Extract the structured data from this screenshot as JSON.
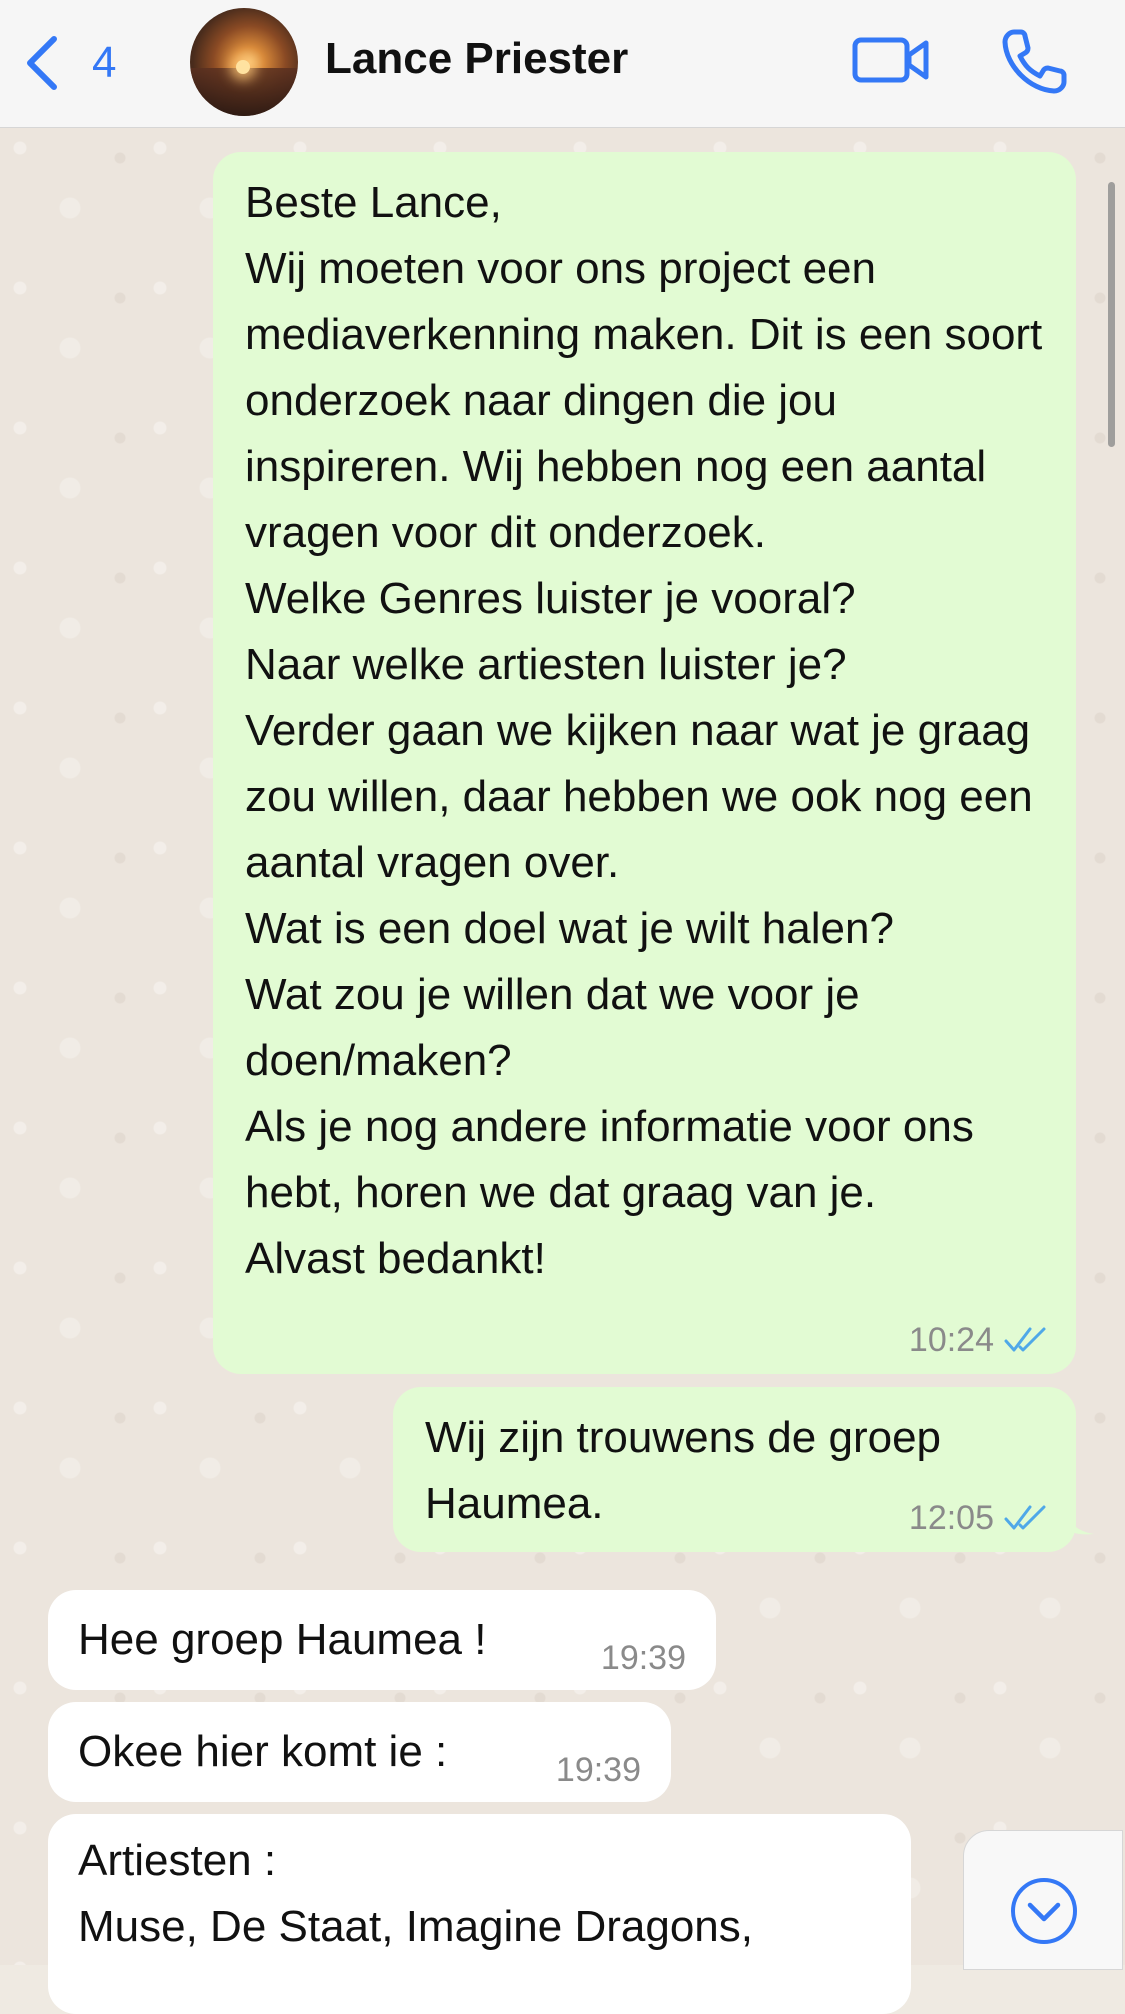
{
  "header": {
    "back_count": "4",
    "contact_name": "Lance Priester"
  },
  "messages": [
    {
      "direction": "out",
      "text": "Beste Lance,\nWij moeten voor ons project een mediaverkenning maken. Dit is een soort onderzoek naar dingen die jou inspireren. Wij hebben nog een aantal vragen voor dit onderzoek.\nWelke Genres luister je vooral?\nNaar welke artiesten luister je?\nVerder gaan we kijken naar wat je graag zou willen, daar hebben we ook nog een aantal vragen over.\nWat is een doel wat je wilt halen?\nWat zou je willen dat we voor je doen/maken?\nAls je nog andere informatie voor ons hebt, horen we dat graag van je.\nAlvast bedankt!",
      "time": "10:24",
      "status": "read"
    },
    {
      "direction": "out",
      "text": "Wij zijn trouwens de groep Haumea.",
      "time": "12:05",
      "status": "read"
    },
    {
      "direction": "in",
      "text": "Hee groep Haumea !",
      "time": "19:39"
    },
    {
      "direction": "in",
      "text": "Okee hier komt ie :",
      "time": "19:39"
    },
    {
      "direction": "in",
      "text": "Artiesten :\nMuse, De Staat, Imagine Dragons,"
    }
  ],
  "colors": {
    "accent": "#3478f6",
    "outgoing_bubble": "#e2fbd3",
    "incoming_bubble": "#ffffff",
    "read_ticks": "#4fa8e8"
  },
  "icons": {
    "back": "chevron-left-icon",
    "video": "video-camera-icon",
    "call": "phone-icon",
    "read": "double-check-icon",
    "scroll": "chevron-down-circle-icon"
  }
}
